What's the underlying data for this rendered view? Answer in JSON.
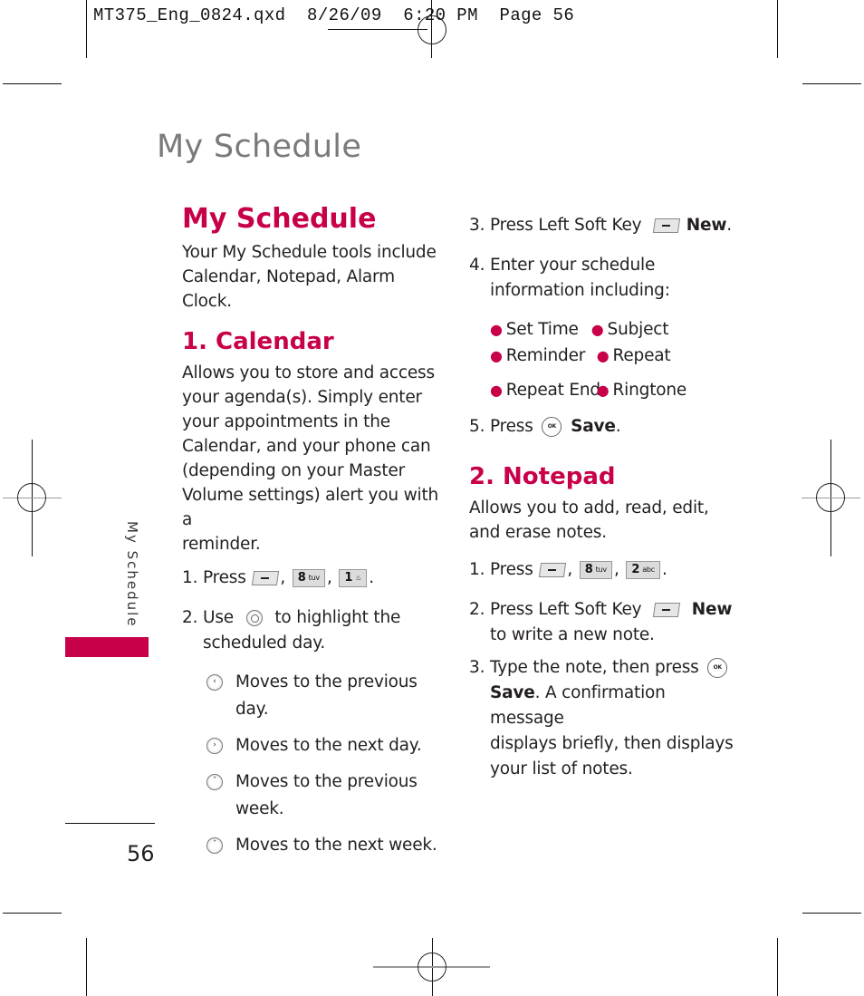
{
  "slug": {
    "filename": "MT375_Eng_0824.qxd",
    "date": "8/26/09",
    "time": "6:20 PM",
    "page_label": "Page 56"
  },
  "running_head": "My Schedule",
  "side_tab_label": "My Schedule",
  "page_number": "56",
  "colors": {
    "accent": "#c8004a",
    "running_head": "#7a7a7a",
    "text": "#231f20"
  },
  "intro": {
    "title": "My Schedule",
    "body_lines": [
      "Your My Schedule tools include",
      "Calendar, Notepad, Alarm Clock."
    ]
  },
  "calendar": {
    "title": "1. Calendar",
    "body_lines": [
      "Allows you to store and access",
      "your agenda(s). Simply enter",
      "your appointments in the",
      "Calendar, and your phone can",
      "(depending on your Master",
      "Volume settings) alert you with a",
      "reminder."
    ],
    "step1": {
      "num": "1.",
      "text": "Press",
      "keys": [
        "left-soft-key",
        "8 tuv",
        "1 voicemail"
      ],
      "key8_digit": "8",
      "key8_letters": "tuv",
      "key1_digit": "1",
      "key1_glyph": "♨",
      "end": "."
    },
    "step2": {
      "num": "2.",
      "pre": "Use",
      "post": "to highlight the",
      "line2": "scheduled day."
    },
    "nav_moves": [
      {
        "icon": "nav-left-icon",
        "glyph": "‹",
        "text": "Moves to the previous day."
      },
      {
        "icon": "nav-right-icon",
        "glyph": "›",
        "text": "Moves to the next day."
      },
      {
        "icon": "nav-up-icon",
        "glyph": "ˆ",
        "text": "Moves to the previous",
        "line2": "week."
      },
      {
        "icon": "nav-down-icon",
        "glyph": "ˇ",
        "text": "Moves to the next week."
      }
    ],
    "step3": {
      "num": "3.",
      "text": "Press Left Soft Key",
      "bold": "New",
      "end": "."
    },
    "step4": {
      "num": "4.",
      "line1": "Enter your schedule",
      "line2": "information including:"
    },
    "fields": [
      [
        "Set Time",
        "Subject"
      ],
      [
        "Reminder",
        "Repeat"
      ],
      [
        "Repeat End",
        "Ringtone"
      ]
    ],
    "step5": {
      "num": "5.",
      "text": "Press",
      "ok_label": "OK",
      "bold": "Save",
      "end": "."
    }
  },
  "notepad": {
    "title": "2. Notepad",
    "body_lines": [
      "Allows you to add, read, edit,",
      "and erase notes."
    ],
    "step1": {
      "num": "1.",
      "text": "Press",
      "key8_digit": "8",
      "key8_letters": "tuv",
      "key2_digit": "2",
      "key2_letters": "abc",
      "end": "."
    },
    "step2": {
      "num": "2.",
      "text": "Press Left Soft Key",
      "bold": "New",
      "line2": "to write a new note."
    },
    "step3": {
      "num": "3.",
      "text": "Type the note, then press",
      "ok_label": "OK",
      "bold": "Save",
      "rest": ". A confirmation message",
      "line3": "displays briefly, then displays",
      "line4": "your list of notes."
    }
  }
}
